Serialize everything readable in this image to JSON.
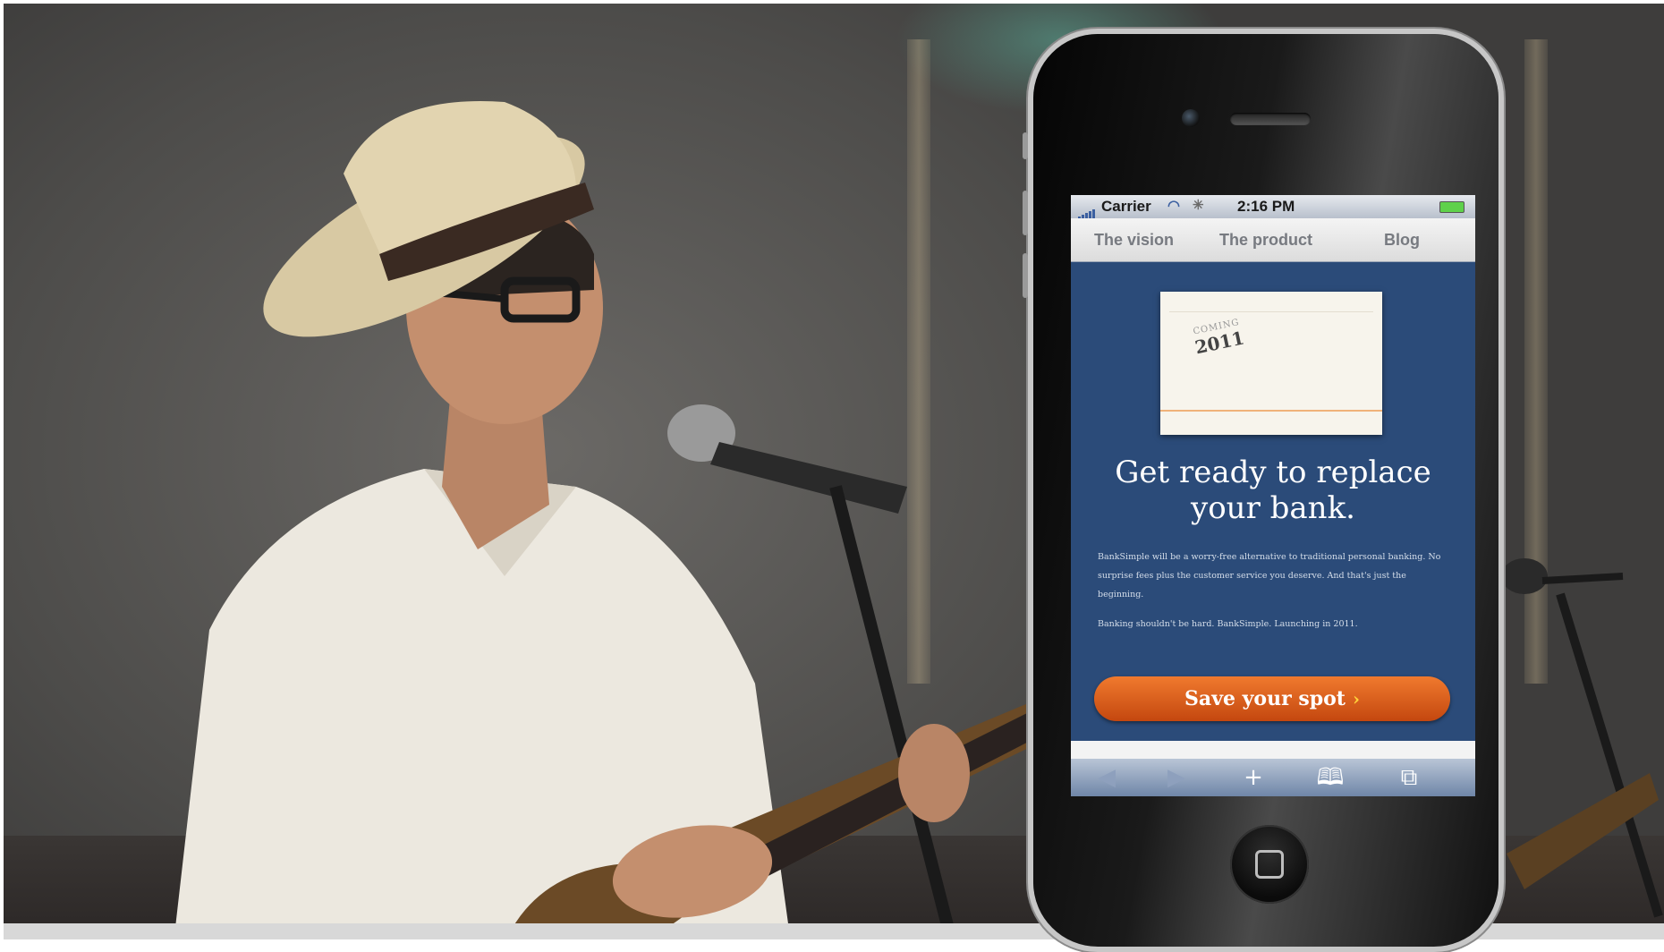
{
  "phone_screen": {
    "status_bar": {
      "carrier": "Carrier",
      "time": "2:16 PM"
    },
    "nav_tabs": [
      "The vision",
      "The product",
      "Blog"
    ],
    "promo_card": {
      "stamp_top": "COMING",
      "stamp_year": "2011"
    },
    "headline": "Get ready to replace your bank.",
    "body_paragraphs": [
      "BankSimple will be a worry-free alternative to traditional personal banking. No surprise fees plus the customer service you deserve. And that's just the beginning.",
      "Banking shouldn't be hard. BankSimple. Launching in 2011."
    ],
    "cta": {
      "label": "Save your spot",
      "arrow": "›"
    },
    "toolbar": {
      "back_icon": "◀",
      "forward_icon": "▶",
      "add_icon": "+",
      "bookmarks_icon": "🕮",
      "tabs_icon": "⧉"
    }
  },
  "colors": {
    "screen_background": "#2b4b79",
    "cta_orange": "#e0601f",
    "nav_text": "#777a80"
  }
}
